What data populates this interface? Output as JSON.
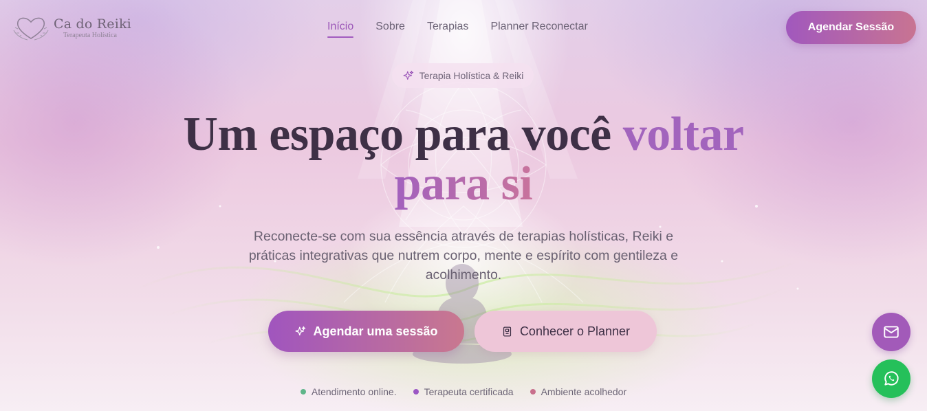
{
  "header": {
    "logo_name": "Ca do Reiki",
    "logo_subtitle": "Terapeuta Holística",
    "nav": [
      {
        "label": "Início",
        "active": true
      },
      {
        "label": "Sobre",
        "active": false
      },
      {
        "label": "Terapias",
        "active": false
      },
      {
        "label": "Planner Reconectar",
        "active": false
      }
    ],
    "cta_label": "Agendar Sessão"
  },
  "hero": {
    "badge": "Terapia Holística & Reiki",
    "headline_part1": "Um espaço para você ",
    "headline_accent1": "voltar",
    "headline_accent2": "para si",
    "subtitle": "Reconecte-se com sua essência através de terapias holísticas, Reiki e práticas integrativas que nutrem corpo, mente e espírito com gentileza e acolhimento.",
    "primary_cta": "Agendar uma sessão",
    "secondary_cta": "Conhecer o Planner",
    "features": [
      {
        "label": "Atendimento online.",
        "color": "#5fb58a"
      },
      {
        "label": "Terapeuta certificada",
        "color": "#9b57c4"
      },
      {
        "label": "Ambiente acolhedor",
        "color": "#c86f8c"
      }
    ]
  },
  "floating": {
    "mail_icon": "mail-icon",
    "whatsapp_icon": "whatsapp-icon"
  },
  "colors": {
    "accent": "#a25bbf",
    "accent_pink": "#c87492",
    "whatsapp": "#25c05a"
  }
}
